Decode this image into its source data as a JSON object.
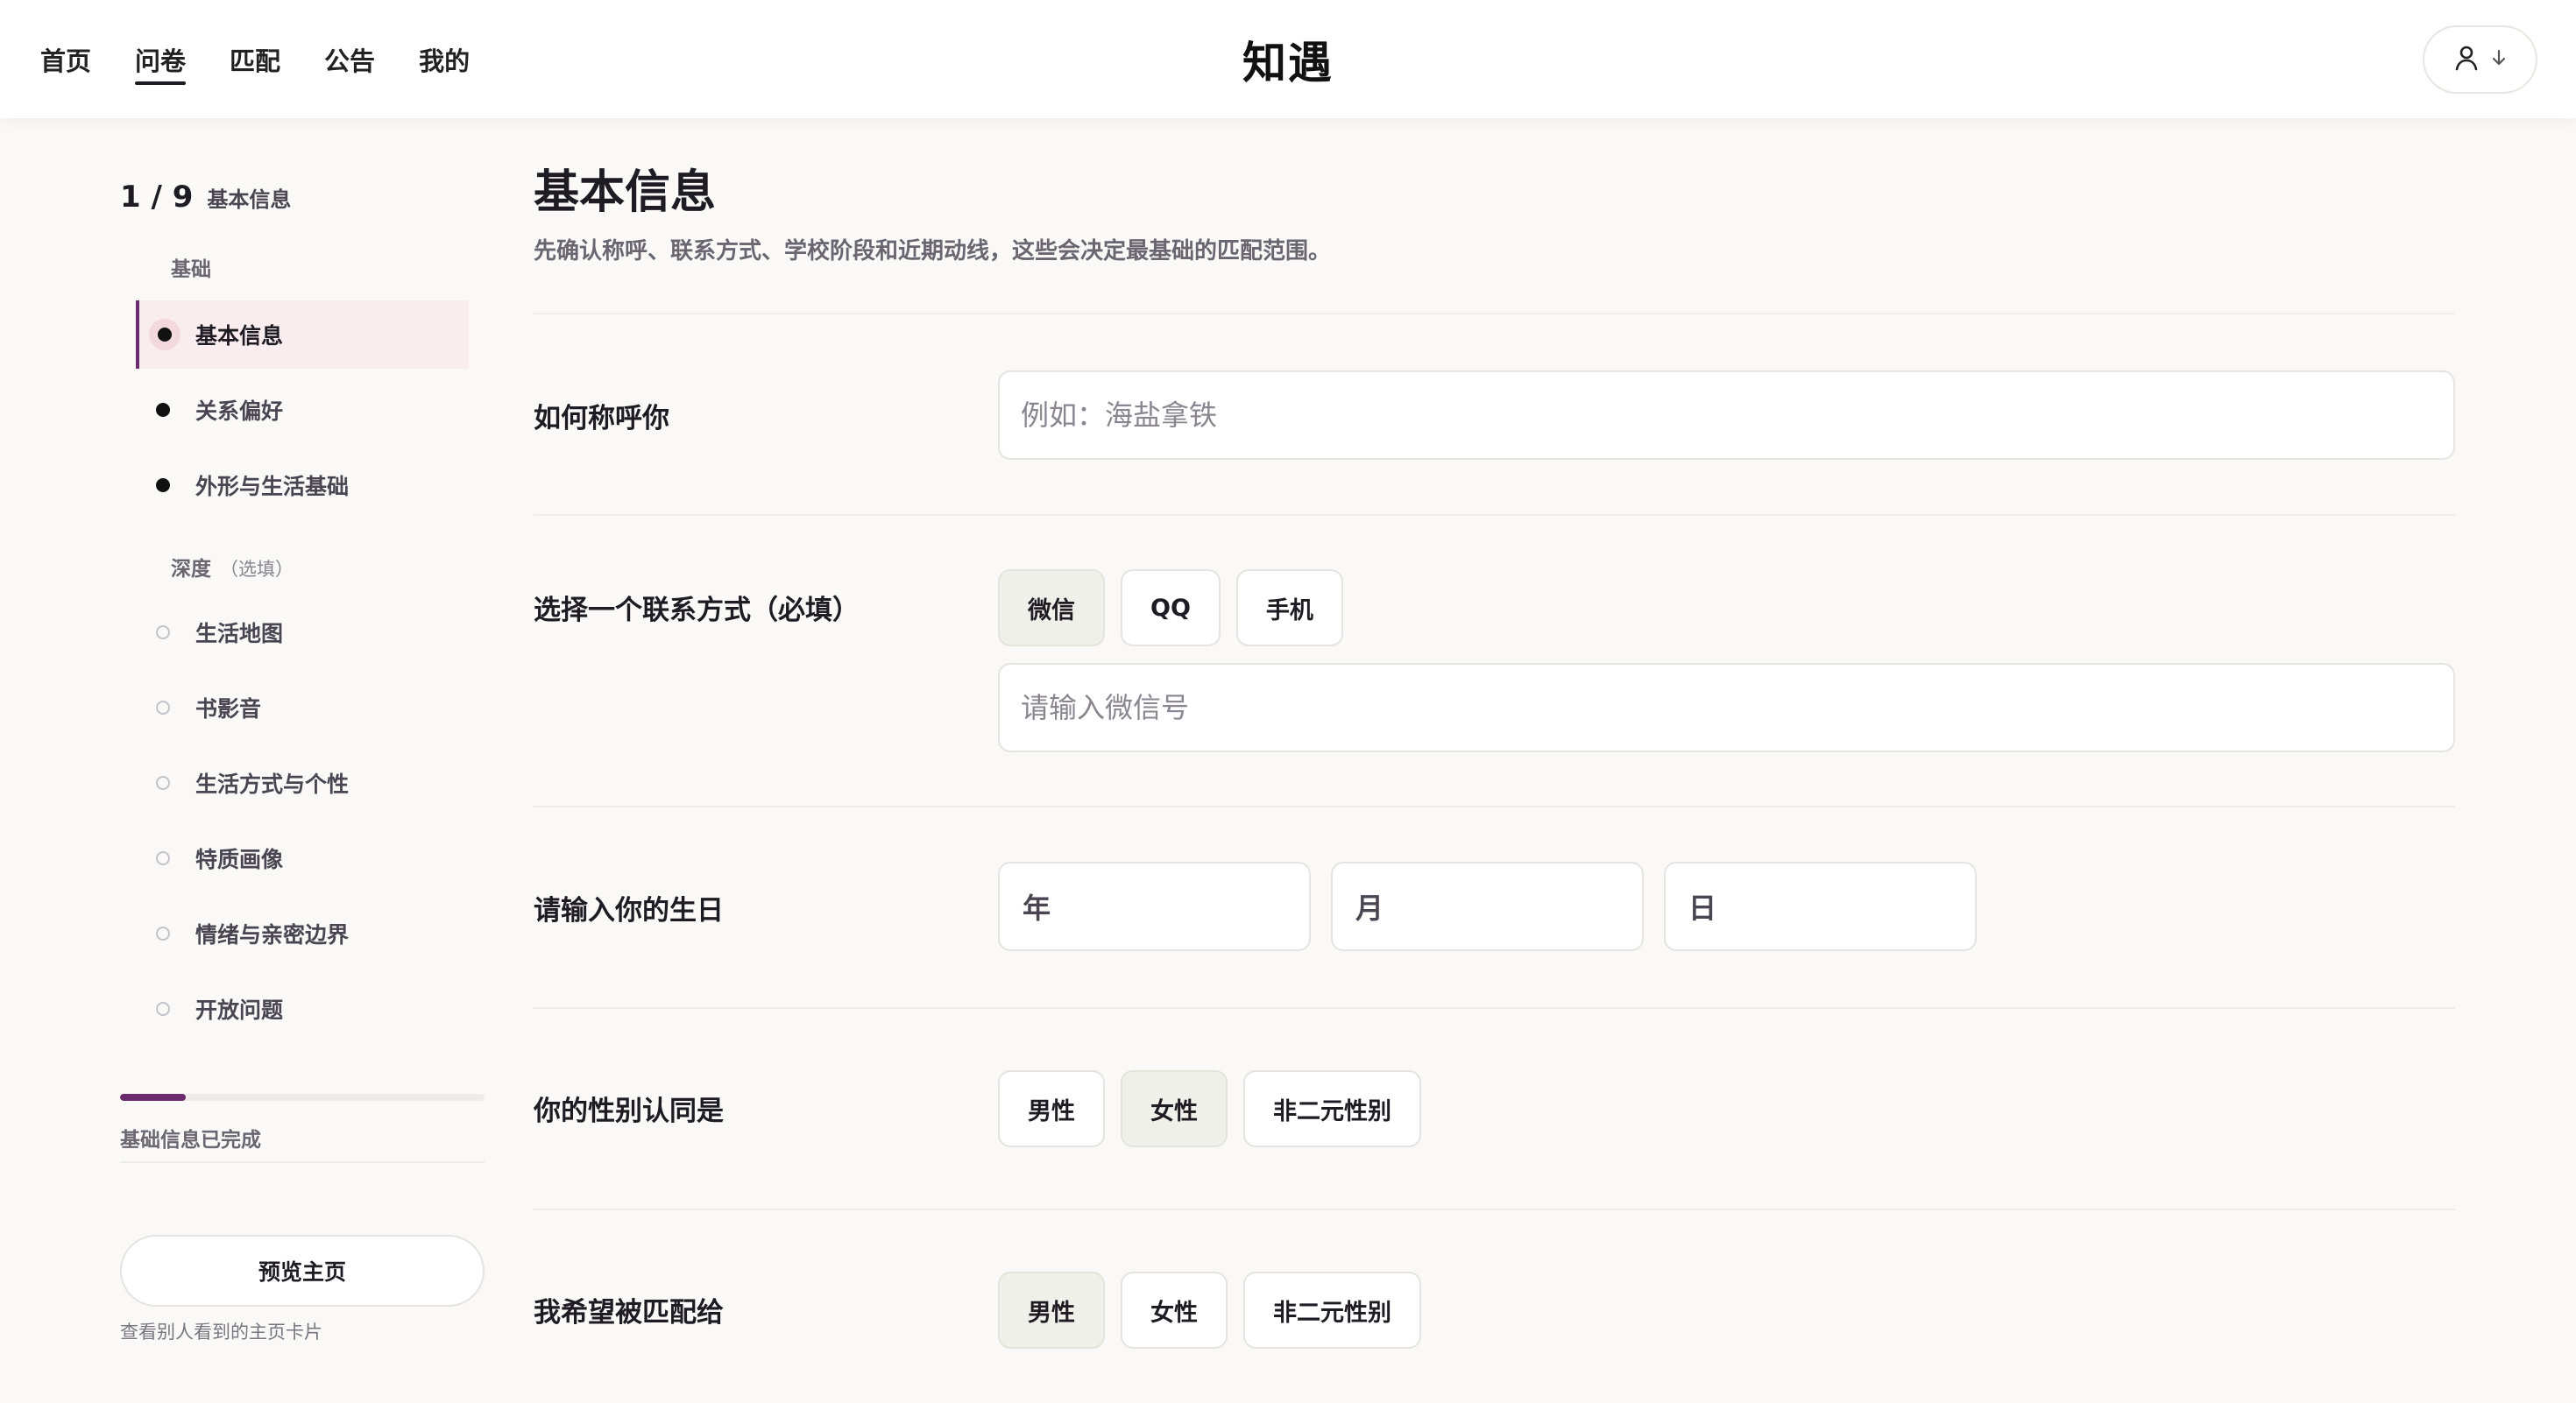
{
  "header": {
    "nav": [
      {
        "label": "首页",
        "active": false
      },
      {
        "label": "问卷",
        "active": true
      },
      {
        "label": "匹配",
        "active": false
      },
      {
        "label": "公告",
        "active": false
      },
      {
        "label": "我的",
        "active": false
      }
    ],
    "brand": "知遇",
    "user_menu": {
      "icon": "user-icon",
      "caret_icon": "arrow-down-icon"
    }
  },
  "sidebar": {
    "step_count": "1 / 9",
    "step_name": "基本信息",
    "groups": [
      {
        "label": "基础",
        "optional_note": "",
        "items": [
          {
            "label": "基本信息",
            "state": "active"
          },
          {
            "label": "关系偏好",
            "state": "required"
          },
          {
            "label": "外形与生活基础",
            "state": "required"
          }
        ]
      },
      {
        "label": "深度",
        "optional_note": "（选填）",
        "items": [
          {
            "label": "生活地图",
            "state": "optional"
          },
          {
            "label": "书影音",
            "state": "optional"
          },
          {
            "label": "生活方式与个性",
            "state": "optional"
          },
          {
            "label": "特质画像",
            "state": "optional"
          },
          {
            "label": "情绪与亲密边界",
            "state": "optional"
          },
          {
            "label": "开放问题",
            "state": "optional"
          }
        ]
      }
    ],
    "progress_fraction": 0.18,
    "progress_text": "基础信息已完成",
    "preview_button": "预览主页",
    "preview_hint": "查看别人看到的主页卡片",
    "accent_color": "#6b2a6e"
  },
  "main": {
    "title": "基本信息",
    "description": "先确认称呼、联系方式、学校阶段和近期动线，这些会决定最基础的匹配范围。",
    "fields": {
      "nickname": {
        "label": "如何称呼你",
        "value": "",
        "placeholder": "例如：海盐拿铁"
      },
      "contact": {
        "label": "选择一个联系方式（必填）",
        "options": [
          {
            "label": "微信",
            "selected": true
          },
          {
            "label": "QQ",
            "selected": false
          },
          {
            "label": "手机",
            "selected": false
          }
        ],
        "value": "",
        "placeholder": "请输入微信号"
      },
      "birthday": {
        "label": "请输入你的生日",
        "year": "年",
        "month": "月",
        "day": "日"
      },
      "gender": {
        "label": "你的性别认同是",
        "options": [
          {
            "label": "男性",
            "selected": false
          },
          {
            "label": "女性",
            "selected": true
          },
          {
            "label": "非二元性别",
            "selected": false
          }
        ]
      },
      "match_gender": {
        "label": "我希望被匹配给",
        "options": [
          {
            "label": "男性",
            "selected": true
          },
          {
            "label": "女性",
            "selected": false
          },
          {
            "label": "非二元性别",
            "selected": false
          }
        ]
      }
    }
  }
}
